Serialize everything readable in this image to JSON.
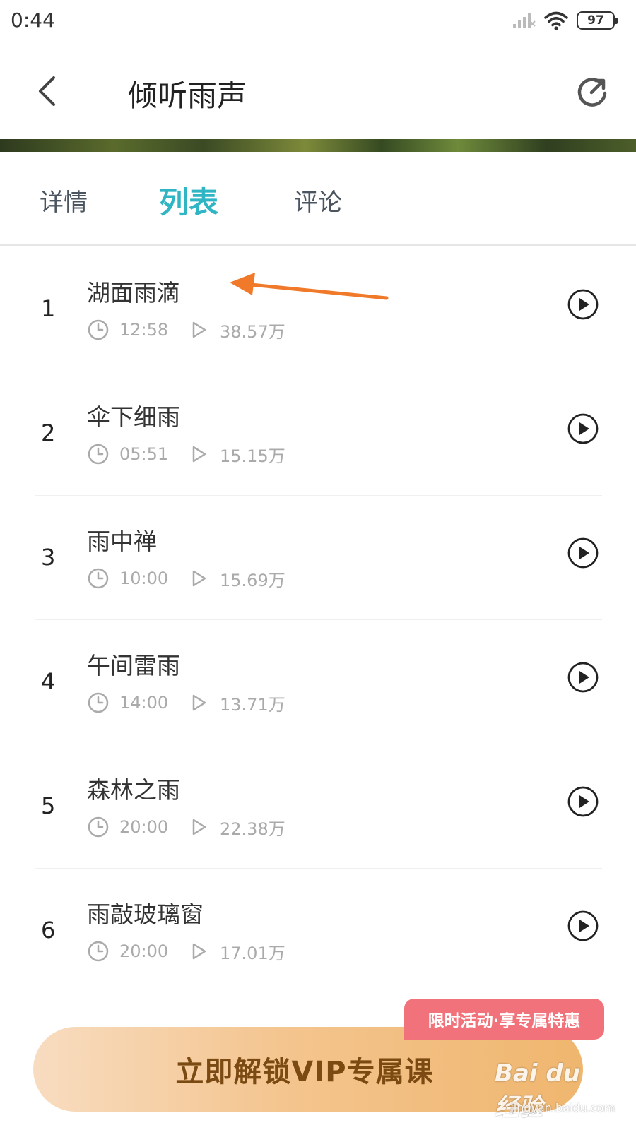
{
  "status_bar": {
    "time": "0:44",
    "battery": "97"
  },
  "header": {
    "title": "倾听雨声"
  },
  "tabs": [
    {
      "label": "详情"
    },
    {
      "label": "列表",
      "active": true
    },
    {
      "label": "评论"
    }
  ],
  "tracks": [
    {
      "index": "1",
      "title": "湖面雨滴",
      "duration": "12:58",
      "plays": "38.57万"
    },
    {
      "index": "2",
      "title": "伞下细雨",
      "duration": "05:51",
      "plays": "15.15万"
    },
    {
      "index": "3",
      "title": "雨中禅",
      "duration": "10:00",
      "plays": "15.69万"
    },
    {
      "index": "4",
      "title": "午间雷雨",
      "duration": "14:00",
      "plays": "13.71万"
    },
    {
      "index": "5",
      "title": "森林之雨",
      "duration": "20:00",
      "plays": "22.38万"
    },
    {
      "index": "6",
      "title": "雨敲玻璃窗",
      "duration": "20:00",
      "plays": "17.01万"
    }
  ],
  "vip": {
    "button_label": "立即解锁VIP专属课",
    "promo_badge": "限时活动·享专属特惠"
  },
  "watermark": {
    "logo_text": "Bai du 经验",
    "url": "jingyan.baidu.com"
  },
  "colors": {
    "accent": "#2fb5c4",
    "annotation_arrow": "#f07a2a",
    "promo_badge": "#f1727a",
    "vip_text": "#7a4a12"
  }
}
